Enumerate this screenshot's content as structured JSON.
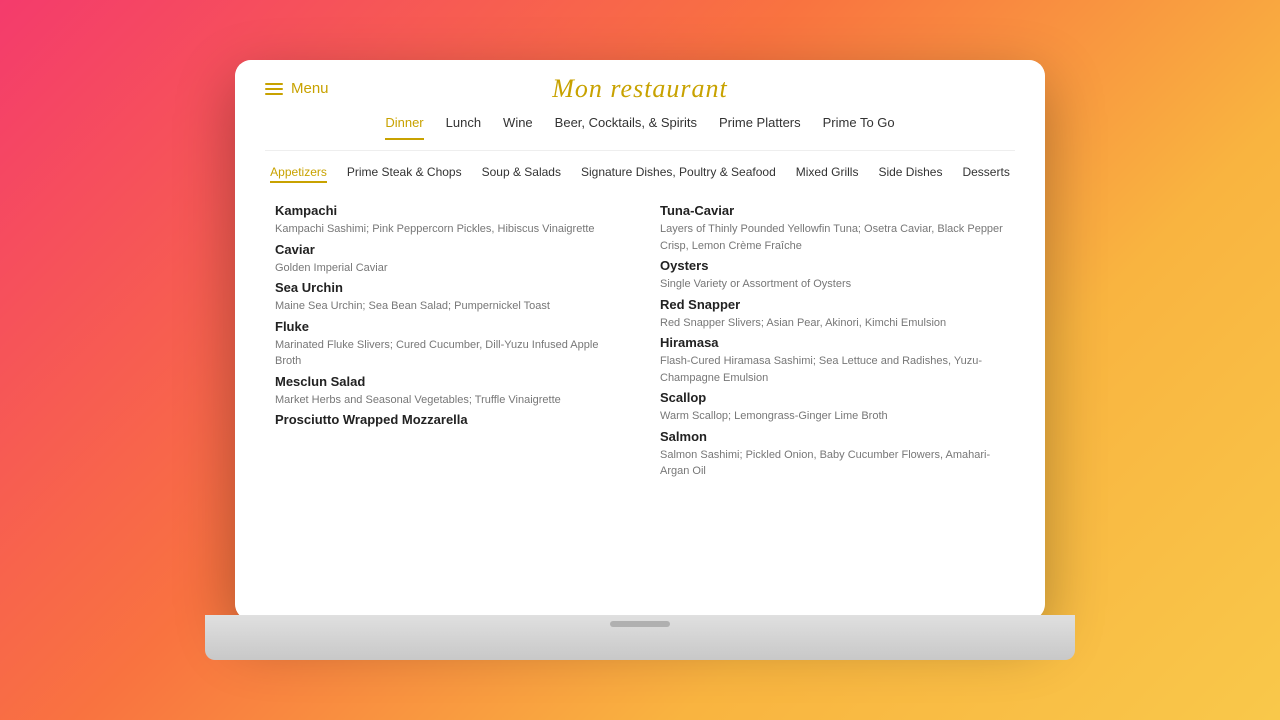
{
  "restaurant": {
    "title": "Mon restaurant",
    "menu_label": "Menu"
  },
  "main_nav": {
    "items": [
      {
        "label": "Dinner",
        "active": true
      },
      {
        "label": "Lunch",
        "active": false
      },
      {
        "label": "Wine",
        "active": false
      },
      {
        "label": "Beer, Cocktails, & Spirits",
        "active": false
      },
      {
        "label": "Prime Platters",
        "active": false
      },
      {
        "label": "Prime To Go",
        "active": false
      }
    ]
  },
  "sub_nav": {
    "items": [
      {
        "label": "Appetizers",
        "active": true
      },
      {
        "label": "Prime Steak & Chops",
        "active": false
      },
      {
        "label": "Soup & Salads",
        "active": false
      },
      {
        "label": "Signature Dishes, Poultry & Seafood",
        "active": false
      },
      {
        "label": "Mixed Grills",
        "active": false
      },
      {
        "label": "Side Dishes",
        "active": false
      },
      {
        "label": "Desserts",
        "active": false
      }
    ]
  },
  "menu_items": {
    "left": [
      {
        "name": "Kampachi",
        "desc": "Kampachi Sashimi; Pink Peppercorn Pickles, Hibiscus Vinaigrette"
      },
      {
        "name": "Caviar",
        "desc": "Golden Imperial Caviar"
      },
      {
        "name": "Sea Urchin",
        "desc": "Maine Sea Urchin; Sea Bean Salad; Pumpernickel Toast"
      },
      {
        "name": "Fluke",
        "desc": "Marinated Fluke Slivers; Cured Cucumber, Dill-Yuzu Infused Apple Broth"
      },
      {
        "name": "Mesclun Salad",
        "desc": "Market Herbs and Seasonal Vegetables; Truffle Vinaigrette"
      },
      {
        "name": "Prosciutto Wrapped Mozzarella",
        "desc": ""
      }
    ],
    "right": [
      {
        "name": "Tuna-Caviar",
        "desc": "Layers of Thinly Pounded Yellowfin Tuna; Osetra Caviar, Black Pepper Crisp, Lemon Crème Fraîche"
      },
      {
        "name": "Oysters",
        "desc": "Single Variety or Assortment of Oysters"
      },
      {
        "name": "Red Snapper",
        "desc": "Red Snapper Slivers; Asian Pear, Akinori, Kimchi Emulsion"
      },
      {
        "name": "Hiramasa",
        "desc": "Flash-Cured Hiramasa Sashimi; Sea Lettuce and Radishes, Yuzu-Champagne Emulsion"
      },
      {
        "name": "Scallop",
        "desc": "Warm Scallop; Lemongrass-Ginger Lime Broth"
      },
      {
        "name": "Salmon",
        "desc": "Salmon Sashimi; Pickled Onion, Baby Cucumber Flowers, Amahari-Argan Oil"
      }
    ]
  }
}
